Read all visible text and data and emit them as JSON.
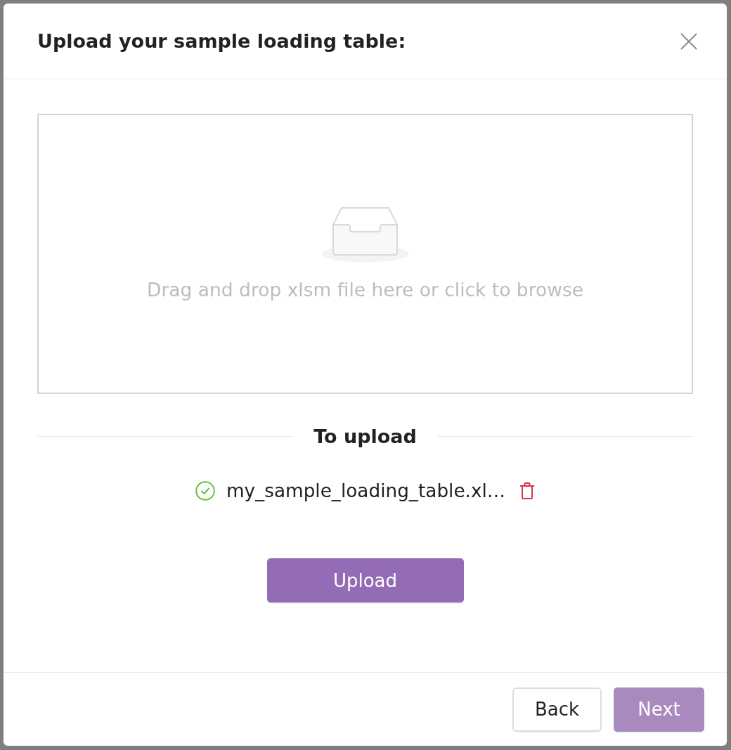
{
  "dialog": {
    "title": "Upload your sample loading table:"
  },
  "dropzone": {
    "hint": "Drag and drop xlsm file here or click to browse"
  },
  "section": {
    "title": "To upload"
  },
  "files": [
    {
      "name": "my_sample_loading_table.xl…",
      "complete": true
    }
  ],
  "upload_button": {
    "label": "Upload",
    "disabled": false
  },
  "footer": {
    "back_button": {
      "label": "Back",
      "disabled": false
    },
    "next_button": {
      "label": "Next",
      "disabled": true
    }
  }
}
